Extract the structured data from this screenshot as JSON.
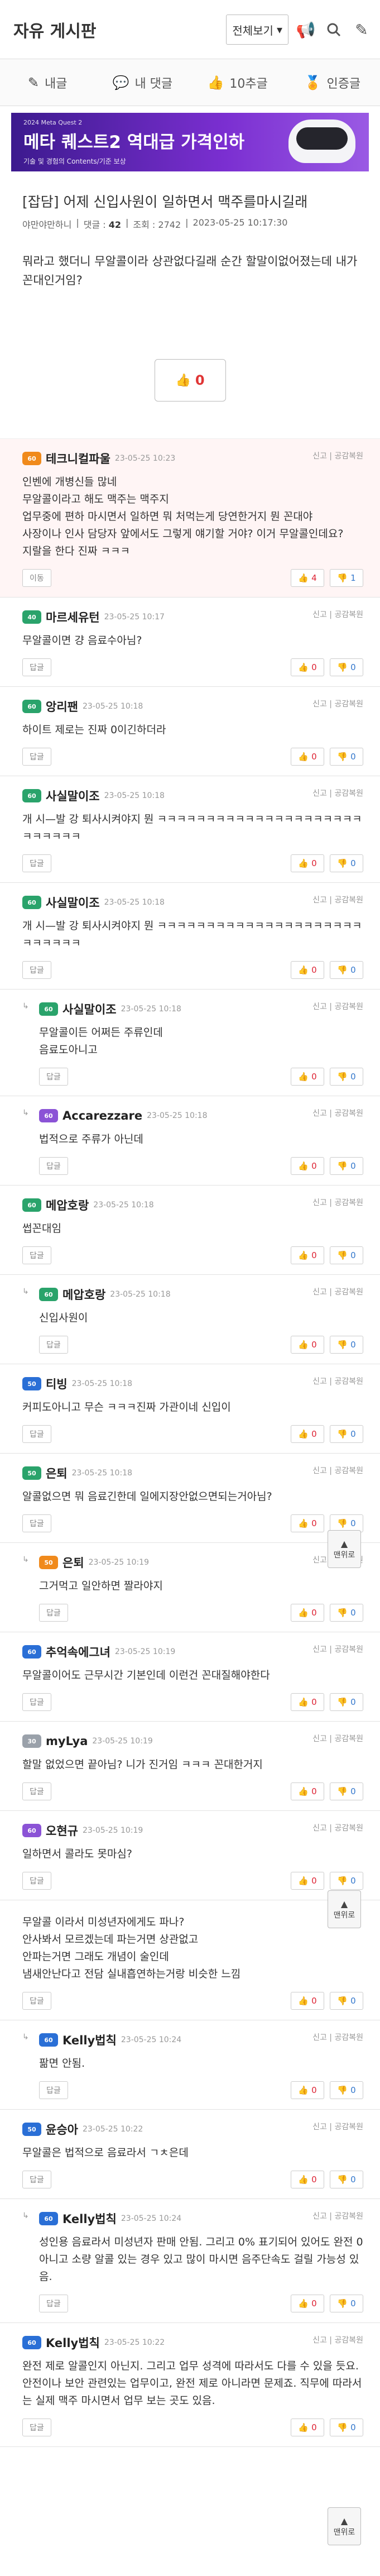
{
  "board": {
    "title": "자유 게시판",
    "filter_label": "전체보기"
  },
  "tabs": [
    {
      "label": "내글",
      "icon": "pencil-icon"
    },
    {
      "label": "내 댓글",
      "icon": "speech-bubble-icon"
    },
    {
      "label": "10추글",
      "icon": "thumbs-up-icon"
    },
    {
      "label": "인증글",
      "icon": "certificate-icon"
    }
  ],
  "banner": {
    "line1": "2024 Meta Quest 2",
    "line2": "메타 퀘스트2 역대급 가격인하",
    "line3": "기술 및 경험의 Contents/기준 보상"
  },
  "post": {
    "category": "[잡담]",
    "title": "어제 신입사원이 일하면서 맥주를마시길래",
    "author": "야만야만하니",
    "comments_label": "댓글",
    "comments_count": "42",
    "views_label": "조회",
    "views": "2742",
    "datetime": "2023-05-25 10:17:30",
    "body": "뭐라고 했더니 무알콜이라 상관없다길래 순간 할말이없어졌는데 내가 꼰대인거임?",
    "like_count": "0"
  },
  "labels": {
    "report": "신고",
    "like_reply": "공감복원",
    "reply": "답글",
    "float_top": "맨위로"
  },
  "comments": [
    {
      "nick": "테크니컬파울",
      "date": "23-05-25 10:23",
      "text": "인벤에 개병신들 많네\n무알콜이라고 해도 맥주는 맥주지\n업무중에 편하 마시면서 일하면 뭐 처먹는게 당연한거지 뭔 꼰대야\n사장이나 인사 담당자 앞에서도 그렇게 얘기할 거야? 이거 무알콜인데요?\n지랄을 한다 진짜 ㅋㅋㅋ",
      "up": "4",
      "down": "1",
      "best": true,
      "reply": false,
      "lvl": "orange",
      "lvlnum": "60",
      "reply_label": "이동"
    },
    {
      "nick": "마르세유턴",
      "date": "23-05-25 10:17",
      "text": "무알콜이면 걍 음료수아님?",
      "up": "0",
      "down": "0",
      "lvl": "green",
      "lvlnum": "40"
    },
    {
      "nick": "앙리팬",
      "date": "23-05-25 10:18",
      "text": "하이트 제로는 진짜 0이긴하더라",
      "up": "0",
      "down": "0",
      "lvl": "green",
      "lvlnum": "60"
    },
    {
      "nick": "사실말이조",
      "date": "23-05-25 10:18",
      "text": "개 시—발 강 퇴사시켜야지 뭔 ㅋㅋㅋㅋㅋㅋㅋㅋㅋㅋㅋㅋㅋㅋㅋㅋㅋㅋㅋㅋㅋㅋㅋㅋㅋㅋㅋ",
      "up": "0",
      "down": "0",
      "lvl": "green",
      "lvlnum": "60"
    },
    {
      "nick": "사실말이조",
      "date": "23-05-25 10:18",
      "text": "개 시—발 강 퇴사시켜야지 뭔 ㅋㅋㅋㅋㅋㅋㅋㅋㅋㅋㅋㅋㅋㅋㅋㅋㅋㅋㅋㅋㅋㅋㅋㅋㅋㅋㅋ",
      "up": "0",
      "down": "0",
      "lvl": "green",
      "lvlnum": "60"
    },
    {
      "nick": "사실말이조",
      "date": "23-05-25 10:18",
      "text": "무알콜이든 어쩌든 주류인데\n음료도아니고",
      "up": "0",
      "down": "0",
      "reply": true,
      "lvl": "green",
      "lvlnum": "60"
    },
    {
      "nick": "Accarezzare",
      "date": "23-05-25 10:18",
      "text": "법적으로 주류가 아닌데",
      "up": "0",
      "down": "0",
      "reply": true,
      "lvl": "purple",
      "lvlnum": "60"
    },
    {
      "nick": "메압호랑",
      "date": "23-05-25 10:18",
      "text": "썹꼰대임",
      "up": "0",
      "down": "0",
      "lvl": "green",
      "lvlnum": "60"
    },
    {
      "nick": "메압호랑",
      "date": "23-05-25 10:18",
      "text": "신입사원이",
      "up": "0",
      "down": "0",
      "reply": true,
      "lvl": "green",
      "lvlnum": "60"
    },
    {
      "nick": "티빙",
      "date": "23-05-25 10:18",
      "text": "커피도아니고 무슨 ㅋㅋㅋ진짜 가관이네 신입이",
      "up": "0",
      "down": "0",
      "lvl": "blue",
      "lvlnum": "50"
    },
    {
      "nick": "은퇴",
      "date": "23-05-25 10:18",
      "text": "알콜없으면 뭐 음료긴한데 일에지장안없으면되는거아님?",
      "up": "0",
      "down": "0",
      "lvl": "green",
      "lvlnum": "50"
    },
    {
      "nick": "은퇴",
      "date": "23-05-25 10:19",
      "text": "그거먹고 일안하면 짤라야지",
      "up": "0",
      "down": "0",
      "reply": true,
      "lvl": "orange",
      "lvlnum": "50"
    },
    {
      "nick": "추억속에그녀",
      "date": "23-05-25 10:19",
      "text": "무알콜이어도 근무시간 기본인데 이런건 꼰대질해야한다",
      "up": "0",
      "down": "0",
      "lvl": "blue",
      "lvlnum": "60"
    },
    {
      "nick": "myLya",
      "date": "23-05-25 10:19",
      "text": "할말 없었으면 끝아님? 니가 진거임 ㅋㅋㅋ 꼰대한거지",
      "up": "0",
      "down": "0",
      "lvl": "gray",
      "lvlnum": "30"
    },
    {
      "nick": "오현규",
      "date": "23-05-25 10:19",
      "text": "일하면서 콜라도 못마심?",
      "up": "0",
      "down": "0",
      "lvl": "purple",
      "lvlnum": "60"
    },
    {
      "nick": "",
      "date": "",
      "text": "무알콜 이라서 미성년자에게도 파나?\n안사봐서 모르겠는데 파는거면 상관없고\n안파는거면 그래도 개념이 술인데\n냄새안난다고 전담 실내흡연하는거랑 비슷한 느낌",
      "up": "0",
      "down": "0",
      "lvl": "green",
      "lvlnum": "",
      "noheader": true
    },
    {
      "nick": "Kelly법칙",
      "date": "23-05-25 10:24",
      "text": "팖면 안됨.",
      "up": "0",
      "down": "0",
      "reply": true,
      "lvl": "blue",
      "lvlnum": "60"
    },
    {
      "nick": "윤승아",
      "date": "23-05-25 10:22",
      "text": "무알콜은 법적으로 음료라서 ㄱㅊ은데",
      "up": "0",
      "down": "0",
      "lvl": "blue",
      "lvlnum": "50"
    },
    {
      "nick": "Kelly법칙",
      "date": "23-05-25 10:24",
      "text": "성인용 음료라서 미성년자 판매 안됨. 그리고 0% 표기되어 있어도 완전 0아니고 소량 알콜 있는 경우 있고 많이 마시면 음주단속도 걸릴 가능성 있음.",
      "up": "0",
      "down": "0",
      "reply": true,
      "lvl": "blue",
      "lvlnum": "60"
    },
    {
      "nick": "Kelly법칙",
      "date": "23-05-25 10:22",
      "text": "완전 제로 알콜인지 아닌지. 그리고 업무 성격에 따라서도 다를 수 있을 듯요. 안전이나 보안 관련있는 업무이고, 완전 제로 아니라면 문제죠. 직무에 따라서는 실제 맥주 마시면서 업무 보는 곳도 있음.",
      "up": "0",
      "down": "0",
      "lvl": "blue",
      "lvlnum": "60"
    }
  ]
}
